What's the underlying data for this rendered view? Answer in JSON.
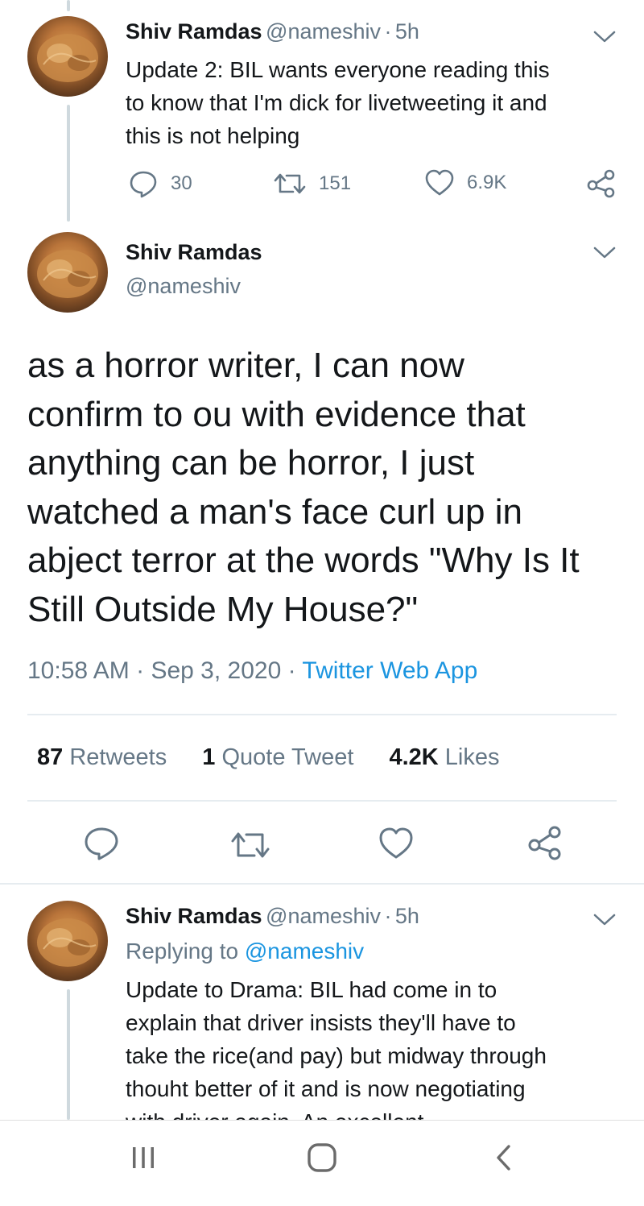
{
  "tweets": [
    {
      "name": "Shiv Ramdas",
      "handle": "@nameshiv",
      "sep": "·",
      "time": "5h",
      "lines": [
        "Update 2: BIL wants everyone reading this",
        "to know that I'm  dick for livetweeting it and",
        "this is not helping"
      ],
      "replies": "30",
      "retweets": "151",
      "likes": "6.9K"
    },
    {
      "name": "Shiv Ramdas",
      "handle": "@nameshiv",
      "sep": "·",
      "time": "5h",
      "replying_label": "Replying to",
      "replying_to": "@nameshiv",
      "lines": [
        "Update to Drama: BIL had come in to",
        "explain that driver insists they'll have to",
        "take the rice(and pay) but midway through",
        "thouht better of it and is now negotiating",
        "with driver again. An excellent"
      ]
    }
  ],
  "main_tweet": {
    "name": "Shiv Ramdas",
    "handle": "@nameshiv",
    "lines": [
      "as a horror writer, I can now",
      "confirm to ou with evidence that",
      "anything can be horror, I just",
      "watched a man's face curl up in",
      "abject terror at the words \"Why Is It",
      "Still Outside My House?\""
    ],
    "time": "10:58 AM",
    "date": "Sep 3, 2020",
    "sep": "·",
    "source": "Twitter Web App",
    "stats": {
      "retweets_count": "87",
      "retweets_label": "Retweets",
      "quotes_count": "1",
      "quotes_label": "Quote Tweet",
      "likes_count": "4.2K",
      "likes_label": "Likes"
    }
  },
  "colors": {
    "text": "#14171a",
    "secondary": "#657786",
    "link": "#1b95e0",
    "divider": "#e6ecf0"
  },
  "icons": [
    "reply-icon",
    "retweet-icon",
    "like-icon",
    "share-icon",
    "chevron-down-icon",
    "recent-apps-icon",
    "home-icon",
    "back-icon"
  ]
}
